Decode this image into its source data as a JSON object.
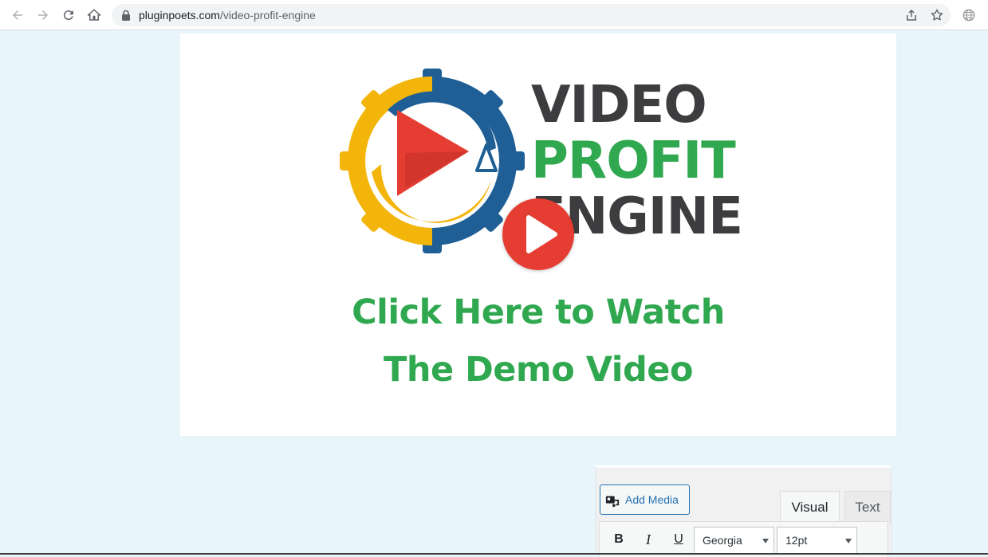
{
  "browser": {
    "url_host": "pluginpoets.com",
    "url_path": "/video-profit-engine"
  },
  "video": {
    "logo_lines": [
      "VIDEO",
      "PROFIT",
      "ENGINE"
    ],
    "cta_lines": [
      "Click Here to Watch",
      "The Demo Video"
    ]
  },
  "editor": {
    "add_media_label": "Add Media",
    "tabs": [
      {
        "label": "Visual",
        "active": true
      },
      {
        "label": "Text",
        "active": false
      }
    ],
    "toolbar": {
      "bold": "B",
      "italic": "I",
      "underline": "U",
      "font_family": "Georgia",
      "font_size": "12pt"
    }
  },
  "colors": {
    "page_bg": "#e8f5fb",
    "brand_green": "#30a850",
    "brand_dark": "#3d3d3f",
    "play_red": "#e63d32",
    "gear_blue": "#1f5f96",
    "gear_yellow": "#f4b50a",
    "link_blue": "#2271b1"
  }
}
